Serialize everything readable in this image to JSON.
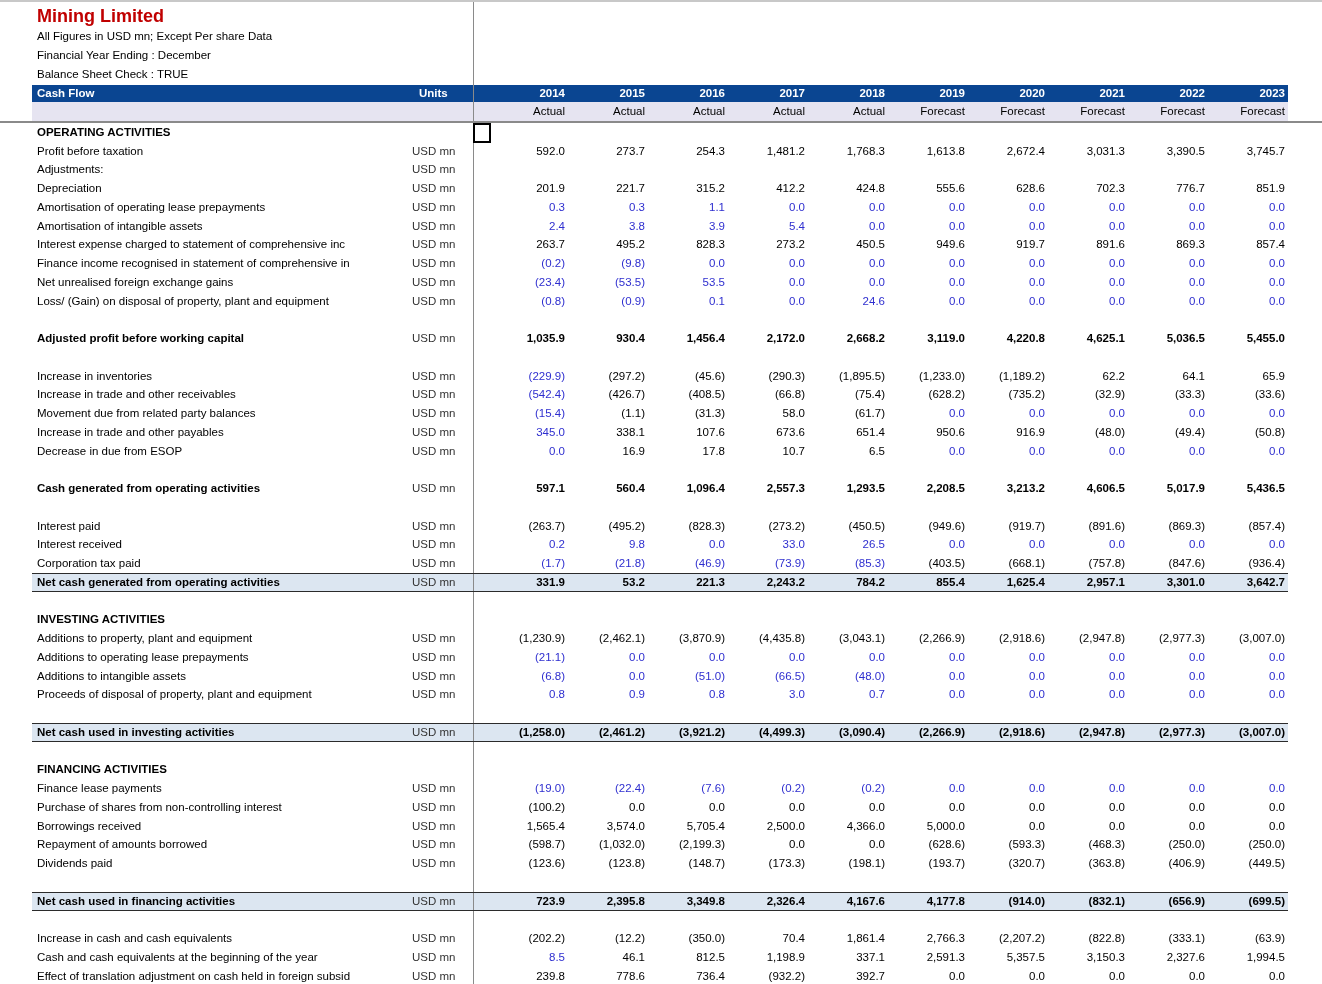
{
  "title": "Mining Limited",
  "notes": [
    "All Figures in USD mn; Except Per share Data",
    "Financial Year Ending : December",
    "Balance Sheet Check : TRUE"
  ],
  "header": {
    "label": "Cash Flow",
    "units": "Units",
    "years": [
      "2014",
      "2015",
      "2016",
      "2017",
      "2018",
      "2019",
      "2020",
      "2021",
      "2022",
      "2023"
    ],
    "periods": [
      "Actual",
      "Actual",
      "Actual",
      "Actual",
      "Actual",
      "Forecast",
      "Forecast",
      "Forecast",
      "Forecast",
      "Forecast"
    ]
  },
  "rows": [
    {
      "kind": "section",
      "label": "OPERATING ACTIVITIES"
    },
    {
      "kind": "item",
      "label": "Profit before taxation",
      "units": "USD mn",
      "values": [
        "592.0",
        "273.7",
        "254.3",
        "1,481.2",
        "1,768.3",
        "1,613.8",
        "2,672.4",
        "3,031.3",
        "3,390.5",
        "3,745.7"
      ],
      "input": [
        false,
        false,
        false,
        false,
        false,
        false,
        false,
        false,
        false,
        false
      ]
    },
    {
      "kind": "item",
      "label": "Adjustments:",
      "units": "USD mn"
    },
    {
      "kind": "item",
      "label": "Depreciation",
      "units": "USD mn",
      "values": [
        "201.9",
        "221.7",
        "315.2",
        "412.2",
        "424.8",
        "555.6",
        "628.6",
        "702.3",
        "776.7",
        "851.9"
      ],
      "input": [
        false,
        false,
        false,
        false,
        false,
        false,
        false,
        false,
        false,
        false
      ]
    },
    {
      "kind": "item",
      "label": "Amortisation of operating lease prepayments",
      "units": "USD mn",
      "values": [
        "0.3",
        "0.3",
        "1.1",
        "0.0",
        "0.0",
        "0.0",
        "0.0",
        "0.0",
        "0.0",
        "0.0"
      ],
      "input": [
        true,
        true,
        true,
        true,
        true,
        true,
        true,
        true,
        true,
        true
      ]
    },
    {
      "kind": "item",
      "label": "Amortisation of intangible assets",
      "units": "USD mn",
      "values": [
        "2.4",
        "3.8",
        "3.9",
        "5.4",
        "0.0",
        "0.0",
        "0.0",
        "0.0",
        "0.0",
        "0.0"
      ],
      "input": [
        true,
        true,
        true,
        true,
        true,
        true,
        true,
        true,
        true,
        true
      ]
    },
    {
      "kind": "item",
      "label": "Interest expense charged to statement of comprehensive inc",
      "units": "USD mn",
      "values": [
        "263.7",
        "495.2",
        "828.3",
        "273.2",
        "450.5",
        "949.6",
        "919.7",
        "891.6",
        "869.3",
        "857.4"
      ],
      "input": [
        false,
        false,
        false,
        false,
        false,
        false,
        false,
        false,
        false,
        false
      ]
    },
    {
      "kind": "item",
      "label": "Finance income recognised in statement of comprehensive in",
      "units": "USD mn",
      "values": [
        "(0.2)",
        "(9.8)",
        "0.0",
        "0.0",
        "0.0",
        "0.0",
        "0.0",
        "0.0",
        "0.0",
        "0.0"
      ],
      "input": [
        true,
        true,
        true,
        true,
        true,
        true,
        true,
        true,
        true,
        true
      ]
    },
    {
      "kind": "item",
      "label": "Net unrealised foreign exchange gains",
      "units": "USD mn",
      "values": [
        "(23.4)",
        "(53.5)",
        "53.5",
        "0.0",
        "0.0",
        "0.0",
        "0.0",
        "0.0",
        "0.0",
        "0.0"
      ],
      "input": [
        true,
        true,
        true,
        true,
        true,
        true,
        true,
        true,
        true,
        true
      ]
    },
    {
      "kind": "item",
      "label": "Loss/ (Gain) on disposal of property, plant and equipment",
      "units": "USD mn",
      "values": [
        "(0.8)",
        "(0.9)",
        "0.1",
        "0.0",
        "24.6",
        "0.0",
        "0.0",
        "0.0",
        "0.0",
        "0.0"
      ],
      "input": [
        true,
        true,
        true,
        true,
        true,
        true,
        true,
        true,
        true,
        true
      ]
    },
    {
      "kind": "blank"
    },
    {
      "kind": "subtotal",
      "label": "Adjusted profit before working capital",
      "units": "USD mn",
      "values": [
        "1,035.9",
        "930.4",
        "1,456.4",
        "2,172.0",
        "2,668.2",
        "3,119.0",
        "4,220.8",
        "4,625.1",
        "5,036.5",
        "5,455.0"
      ]
    },
    {
      "kind": "blank"
    },
    {
      "kind": "item",
      "label": "Increase in inventories",
      "units": "USD mn",
      "values": [
        "(229.9)",
        "(297.2)",
        "(45.6)",
        "(290.3)",
        "(1,895.5)",
        "(1,233.0)",
        "(1,189.2)",
        "62.2",
        "64.1",
        "65.9"
      ],
      "input": [
        true,
        false,
        false,
        false,
        false,
        false,
        false,
        false,
        false,
        false
      ]
    },
    {
      "kind": "item",
      "label": "Increase in trade and other receivables",
      "units": "USD mn",
      "values": [
        "(542.4)",
        "(426.7)",
        "(408.5)",
        "(66.8)",
        "(75.4)",
        "(628.2)",
        "(735.2)",
        "(32.9)",
        "(33.3)",
        "(33.6)"
      ],
      "input": [
        true,
        false,
        false,
        false,
        false,
        false,
        false,
        false,
        false,
        false
      ]
    },
    {
      "kind": "item",
      "label": "Movement due from related party balances",
      "units": "USD mn",
      "values": [
        "(15.4)",
        "(1.1)",
        "(31.3)",
        "58.0",
        "(61.7)",
        "0.0",
        "0.0",
        "0.0",
        "0.0",
        "0.0"
      ],
      "input": [
        true,
        false,
        false,
        false,
        false,
        true,
        true,
        true,
        true,
        true
      ]
    },
    {
      "kind": "item",
      "label": "Increase in trade and other payables",
      "units": "USD mn",
      "values": [
        "345.0",
        "338.1",
        "107.6",
        "673.6",
        "651.4",
        "950.6",
        "916.9",
        "(48.0)",
        "(49.4)",
        "(50.8)"
      ],
      "input": [
        true,
        false,
        false,
        false,
        false,
        false,
        false,
        false,
        false,
        false
      ]
    },
    {
      "kind": "item",
      "label": "Decrease in due from ESOP",
      "units": "USD mn",
      "values": [
        "0.0",
        "16.9",
        "17.8",
        "10.7",
        "6.5",
        "0.0",
        "0.0",
        "0.0",
        "0.0",
        "0.0"
      ],
      "input": [
        true,
        false,
        false,
        false,
        false,
        true,
        true,
        true,
        true,
        true
      ]
    },
    {
      "kind": "blank"
    },
    {
      "kind": "subtotal",
      "label": "Cash generated from operating activities",
      "units": "USD mn",
      "values": [
        "597.1",
        "560.4",
        "1,096.4",
        "2,557.3",
        "1,293.5",
        "2,208.5",
        "3,213.2",
        "4,606.5",
        "5,017.9",
        "5,436.5"
      ]
    },
    {
      "kind": "blank"
    },
    {
      "kind": "item",
      "label": "Interest paid",
      "units": "USD mn",
      "values": [
        "(263.7)",
        "(495.2)",
        "(828.3)",
        "(273.2)",
        "(450.5)",
        "(949.6)",
        "(919.7)",
        "(891.6)",
        "(869.3)",
        "(857.4)"
      ],
      "input": [
        false,
        false,
        false,
        false,
        false,
        false,
        false,
        false,
        false,
        false
      ]
    },
    {
      "kind": "item",
      "label": "Interest received",
      "units": "USD mn",
      "values": [
        "0.2",
        "9.8",
        "0.0",
        "33.0",
        "26.5",
        "0.0",
        "0.0",
        "0.0",
        "0.0",
        "0.0"
      ],
      "input": [
        true,
        true,
        true,
        true,
        true,
        true,
        true,
        true,
        true,
        true
      ]
    },
    {
      "kind": "item",
      "label": "Corporation tax paid",
      "units": "USD mn",
      "values": [
        "(1.7)",
        "(21.8)",
        "(46.9)",
        "(73.9)",
        "(85.3)",
        "(403.5)",
        "(668.1)",
        "(757.8)",
        "(847.6)",
        "(936.4)"
      ],
      "input": [
        true,
        true,
        true,
        true,
        true,
        false,
        false,
        false,
        false,
        false
      ]
    },
    {
      "kind": "total",
      "label": "Net cash generated from operating activities",
      "units": "USD mn",
      "values": [
        "331.9",
        "53.2",
        "221.3",
        "2,243.2",
        "784.2",
        "855.4",
        "1,625.4",
        "2,957.1",
        "3,301.0",
        "3,642.7"
      ]
    },
    {
      "kind": "blank"
    },
    {
      "kind": "section",
      "label": "INVESTING ACTIVITIES"
    },
    {
      "kind": "item",
      "label": "Additions to property, plant and equipment",
      "units": "USD mn",
      "values": [
        "(1,230.9)",
        "(2,462.1)",
        "(3,870.9)",
        "(4,435.8)",
        "(3,043.1)",
        "(2,266.9)",
        "(2,918.6)",
        "(2,947.8)",
        "(2,977.3)",
        "(3,007.0)"
      ],
      "input": [
        false,
        false,
        false,
        false,
        false,
        false,
        false,
        false,
        false,
        false
      ]
    },
    {
      "kind": "item",
      "label": "Additions to operating lease prepayments",
      "units": "USD mn",
      "values": [
        "(21.1)",
        "0.0",
        "0.0",
        "0.0",
        "0.0",
        "0.0",
        "0.0",
        "0.0",
        "0.0",
        "0.0"
      ],
      "input": [
        true,
        true,
        true,
        true,
        true,
        true,
        true,
        true,
        true,
        true
      ]
    },
    {
      "kind": "item",
      "label": "Additions to intangible assets",
      "units": "USD mn",
      "values": [
        "(6.8)",
        "0.0",
        "(51.0)",
        "(66.5)",
        "(48.0)",
        "0.0",
        "0.0",
        "0.0",
        "0.0",
        "0.0"
      ],
      "input": [
        true,
        true,
        true,
        true,
        true,
        true,
        true,
        true,
        true,
        true
      ]
    },
    {
      "kind": "item",
      "label": "Proceeds of disposal of property, plant and equipment",
      "units": "USD mn",
      "values": [
        "0.8",
        "0.9",
        "0.8",
        "3.0",
        "0.7",
        "0.0",
        "0.0",
        "0.0",
        "0.0",
        "0.0"
      ],
      "input": [
        true,
        true,
        true,
        true,
        true,
        true,
        true,
        true,
        true,
        true
      ]
    },
    {
      "kind": "blank"
    },
    {
      "kind": "total",
      "label": "Net cash used in investing activities",
      "units": "USD mn",
      "values": [
        "(1,258.0)",
        "(2,461.2)",
        "(3,921.2)",
        "(4,499.3)",
        "(3,090.4)",
        "(2,266.9)",
        "(2,918.6)",
        "(2,947.8)",
        "(2,977.3)",
        "(3,007.0)"
      ]
    },
    {
      "kind": "blank"
    },
    {
      "kind": "section",
      "label": "FINANCING ACTIVITIES"
    },
    {
      "kind": "item",
      "label": "Finance lease payments",
      "units": "USD mn",
      "values": [
        "(19.0)",
        "(22.4)",
        "(7.6)",
        "(0.2)",
        "(0.2)",
        "0.0",
        "0.0",
        "0.0",
        "0.0",
        "0.0"
      ],
      "input": [
        true,
        true,
        true,
        true,
        true,
        true,
        true,
        true,
        true,
        true
      ]
    },
    {
      "kind": "item",
      "label": "Purchase of shares from non-controlling interest",
      "units": "USD mn",
      "values": [
        "(100.2)",
        "0.0",
        "0.0",
        "0.0",
        "0.0",
        "0.0",
        "0.0",
        "0.0",
        "0.0",
        "0.0"
      ],
      "input": [
        false,
        false,
        false,
        false,
        false,
        false,
        false,
        false,
        false,
        false
      ]
    },
    {
      "kind": "item",
      "label": "Borrowings received",
      "units": "USD mn",
      "values": [
        "1,565.4",
        "3,574.0",
        "5,705.4",
        "2,500.0",
        "4,366.0",
        "5,000.0",
        "0.0",
        "0.0",
        "0.0",
        "0.0"
      ],
      "input": [
        false,
        false,
        false,
        false,
        false,
        false,
        false,
        false,
        false,
        false
      ]
    },
    {
      "kind": "item",
      "label": "Repayment of amounts borrowed",
      "units": "USD mn",
      "values": [
        "(598.7)",
        "(1,032.0)",
        "(2,199.3)",
        "0.0",
        "0.0",
        "(628.6)",
        "(593.3)",
        "(468.3)",
        "(250.0)",
        "(250.0)"
      ],
      "input": [
        false,
        false,
        false,
        false,
        false,
        false,
        false,
        false,
        false,
        false
      ]
    },
    {
      "kind": "item",
      "label": "Dividends paid",
      "units": "USD mn",
      "values": [
        "(123.6)",
        "(123.8)",
        "(148.7)",
        "(173.3)",
        "(198.1)",
        "(193.7)",
        "(320.7)",
        "(363.8)",
        "(406.9)",
        "(449.5)"
      ],
      "input": [
        false,
        false,
        false,
        false,
        false,
        false,
        false,
        false,
        false,
        false
      ]
    },
    {
      "kind": "blank"
    },
    {
      "kind": "total",
      "label": "Net cash used in financing activities",
      "units": "USD mn",
      "values": [
        "723.9",
        "2,395.8",
        "3,349.8",
        "2,326.4",
        "4,167.6",
        "4,177.8",
        "(914.0)",
        "(832.1)",
        "(656.9)",
        "(699.5)"
      ]
    },
    {
      "kind": "blank"
    },
    {
      "kind": "item",
      "label": "Increase in cash and cash equivalents",
      "units": "USD mn",
      "values": [
        "(202.2)",
        "(12.2)",
        "(350.0)",
        "70.4",
        "1,861.4",
        "2,766.3",
        "(2,207.2)",
        "(822.8)",
        "(333.1)",
        "(63.9)"
      ],
      "input": [
        false,
        false,
        false,
        false,
        false,
        false,
        false,
        false,
        false,
        false
      ]
    },
    {
      "kind": "item",
      "label": "Cash and cash equivalents at the beginning of the year",
      "units": "USD mn",
      "values": [
        "8.5",
        "46.1",
        "812.5",
        "1,198.9",
        "337.1",
        "2,591.3",
        "5,357.5",
        "3,150.3",
        "2,327.6",
        "1,994.5"
      ],
      "input": [
        true,
        false,
        false,
        false,
        false,
        false,
        false,
        false,
        false,
        false
      ]
    },
    {
      "kind": "item",
      "label": "Effect of translation adjustment on cash held in foreign subsid",
      "units": "USD mn",
      "values": [
        "239.8",
        "778.6",
        "736.4",
        "(932.2)",
        "392.7",
        "0.0",
        "0.0",
        "0.0",
        "0.0",
        "0.0"
      ],
      "input": [
        false,
        false,
        false,
        false,
        false,
        false,
        false,
        false,
        false,
        false
      ]
    }
  ]
}
